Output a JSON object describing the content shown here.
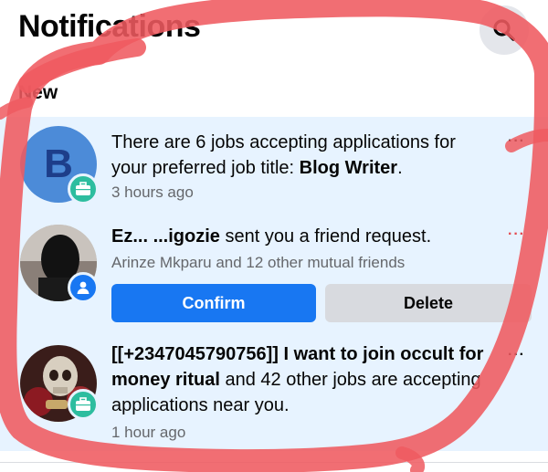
{
  "header": {
    "title": "Notifications",
    "search_icon": "search-icon"
  },
  "section": {
    "label": "New"
  },
  "notifications": [
    {
      "avatar_letter": "B",
      "badge_icon": "briefcase-icon",
      "text_prefix": "There are 6 jobs accepting applications for your preferred job title: ",
      "text_bold": "Blog Writer",
      "text_suffix": ".",
      "time": "3 hours ago",
      "more": "···"
    },
    {
      "name": "Ez... ...igozie",
      "badge_icon": "person-icon",
      "text_suffix": " sent you a friend request.",
      "mutual": "Arinze Mkparu and 12 other mutual friends",
      "confirm_label": "Confirm",
      "delete_label": "Delete",
      "more": "···"
    },
    {
      "badge_icon": "briefcase-icon",
      "text_bold": "[[+2347045790756]] I want to join occult for money ritual",
      "text_suffix": " and 42 other jobs are accepting applications near you.",
      "time": "1 hour ago",
      "more": "···"
    }
  ],
  "colors": {
    "unread_bg": "#e7f3ff",
    "primary": "#1877f2",
    "job_badge": "#2dbd9f",
    "annotation": "#ef5a60"
  }
}
